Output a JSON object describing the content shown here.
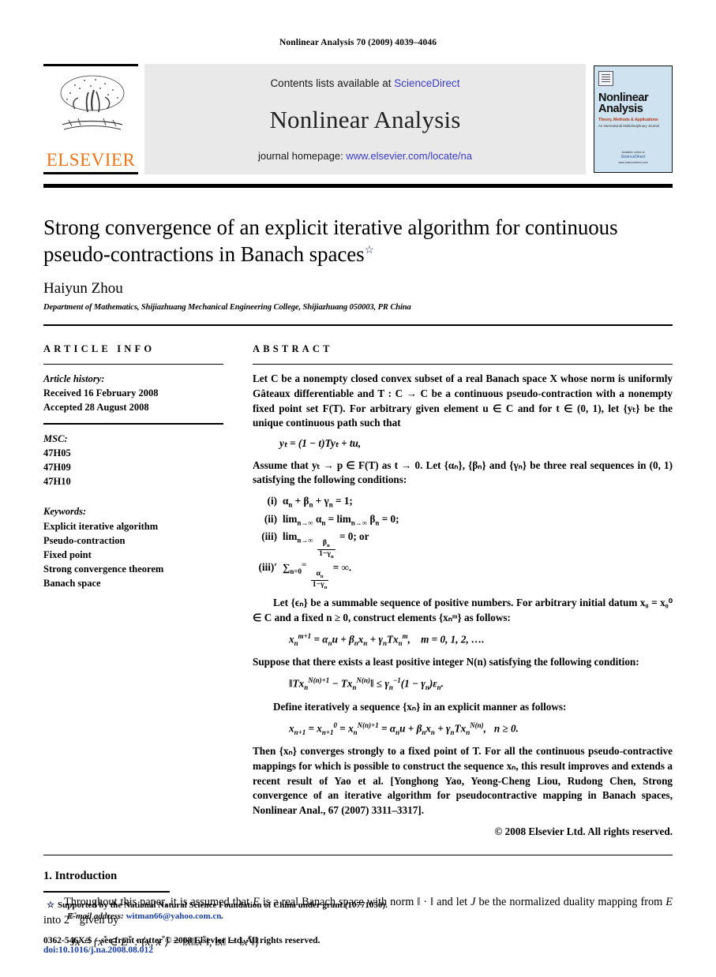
{
  "running_head": "Nonlinear Analysis 70 (2009) 4039–4046",
  "banner": {
    "publisher_logo_text": "ELSEVIER",
    "publisher_logo_icon": "elsevier-tree-logo",
    "contents_prefix": "Contents lists available at ",
    "contents_link": "ScienceDirect",
    "journal_name": "Nonlinear Analysis",
    "homepage_prefix": "journal homepage: ",
    "homepage_link": "www.elsevier.com/locate/na",
    "cover": {
      "title": "Nonlinear Analysis",
      "subtitle": "Theory, Methods & Applications",
      "subtitle2": "An International Multidisciplinary Journal",
      "footer_line1": "Available online at",
      "footer_brand": "ScienceDirect",
      "footer_line2": "www.sciencedirect.com"
    },
    "accent_orange": "#e8741e",
    "link_blue": "#3b3bc4",
    "cover_bg": "#cfe2f0",
    "panel_bg": "#e9e9e9"
  },
  "title": {
    "line1": "Strong convergence of an explicit iterative algorithm for continuous",
    "line2": "pseudo-contractions in Banach spaces",
    "footnote_marker": "☆"
  },
  "author": "Haiyun Zhou",
  "affiliation": "Department of Mathematics, Shijiazhuang Mechanical Engineering College, Shijiazhuang 050003, PR China",
  "article_info": {
    "heading": "ARTICLE INFO",
    "history_label": "Article history:",
    "history": [
      "Received 16 February 2008",
      "Accepted 28 August 2008"
    ],
    "msc_label": "MSC:",
    "msc": [
      "47H05",
      "47H09",
      "47H10"
    ],
    "keywords_label": "Keywords:",
    "keywords": [
      "Explicit iterative algorithm",
      "Pseudo-contraction",
      "Fixed point",
      "Strong convergence theorem",
      "Banach space"
    ]
  },
  "abstract": {
    "heading": "ABSTRACT",
    "p1": "Let C be a nonempty closed convex subset of a real Banach space X whose norm is uniformly Gâteaux differentiable and T : C → C be a continuous pseudo-contraction with a nonempty fixed point set F(T). For arbitrary given element u ∈ C and for t ∈ (0, 1), let {yₜ} be the unique continuous path such that",
    "eq1": "yₜ = (1 − t)Tyₜ + tu,",
    "p2": "Assume that yₜ → p ∈ F(T) as t → 0. Let {αₙ}, {βₙ} and {γₙ} be three real sequences in (0, 1) satisfying the following conditions:",
    "conditions": [
      {
        "num": "(i)",
        "text": "αₙ + βₙ + γₙ = 1;"
      },
      {
        "num": "(ii)",
        "text": "limₙ→∞ αₙ = limₙ→∞ βₙ = 0;"
      },
      {
        "num": "(iii)",
        "text": "limₙ→∞ βₙ/(1−γₙ) = 0; or"
      },
      {
        "num": "(iii)′",
        "text": "∑ₙ₌₀ⁿ αₙ/(1−γₙ) = ∞."
      }
    ],
    "p3": "Let {ϵₙ} be a summable sequence of positive numbers. For arbitrary initial datum x₀ = x₀⁰ ∈ C and a fixed n ≥ 0, construct elements {xₙᵐ} as follows:",
    "eq2": "xₙᵐ⁺¹ = αₙu + βₙxₙ + γₙTxₙᵐ,    m = 0, 1, 2, ….",
    "p4": "Suppose that there exists a least positive integer N(n) satisfying the following condition:",
    "eq3": "‖Txₙ^{N(n)+1} − Txₙ^{N(n)}‖ ≤ γₙ⁻¹(1 − γₙ)ϵₙ.",
    "p5": "Define iteratively a sequence {xₙ} in an explicit manner as follows:",
    "eq4": "xₙ₊₁ = xₙ₊₁⁰ = xₙ^{N(n)+1} = αₙu + βₙxₙ + γₙTxₙ^{N(n)},   n ≥ 0.",
    "p6": "Then {xₙ} converges strongly to a fixed point of T. For all the continuous pseudo-contractive mappings for which is possible to construct the sequence xₙ, this result improves and extends a recent result of Yao et al. [Yonghong Yao, Yeong-Cheng Liou, Rudong Chen, Strong convergence of an iterative algorithm for pseudocontractive mapping in Banach spaces, Nonlinear Anal., 67 (2007) 3311–3317].",
    "copyright": "© 2008 Elsevier Ltd. All rights reserved."
  },
  "introduction": {
    "heading": "1. Introduction",
    "paragraph": "Throughout this paper, it is assumed that E is a real Banach space with norm ‖ · ‖ and let J be the normalized duality mapping from E into 2^{E*} given by",
    "equation": "Jx = {x* ∈ E* : ⟨x, x*⟩ = ‖x‖‖x*‖, ‖x‖ = ‖x*‖}"
  },
  "footer": {
    "star": "☆",
    "grant_note": "Supported by the National Natural Science Foundation of China under grant (10771050).",
    "email_label": "E-mail address:",
    "email": "witman66@yahoo.com.cn",
    "email_suffix": ".",
    "issn_line": "0362-546X/$ – see front matter © 2008 Elsevier Ltd. All rights reserved.",
    "doi_line": "doi:10.1016/j.na.2008.08.012"
  }
}
